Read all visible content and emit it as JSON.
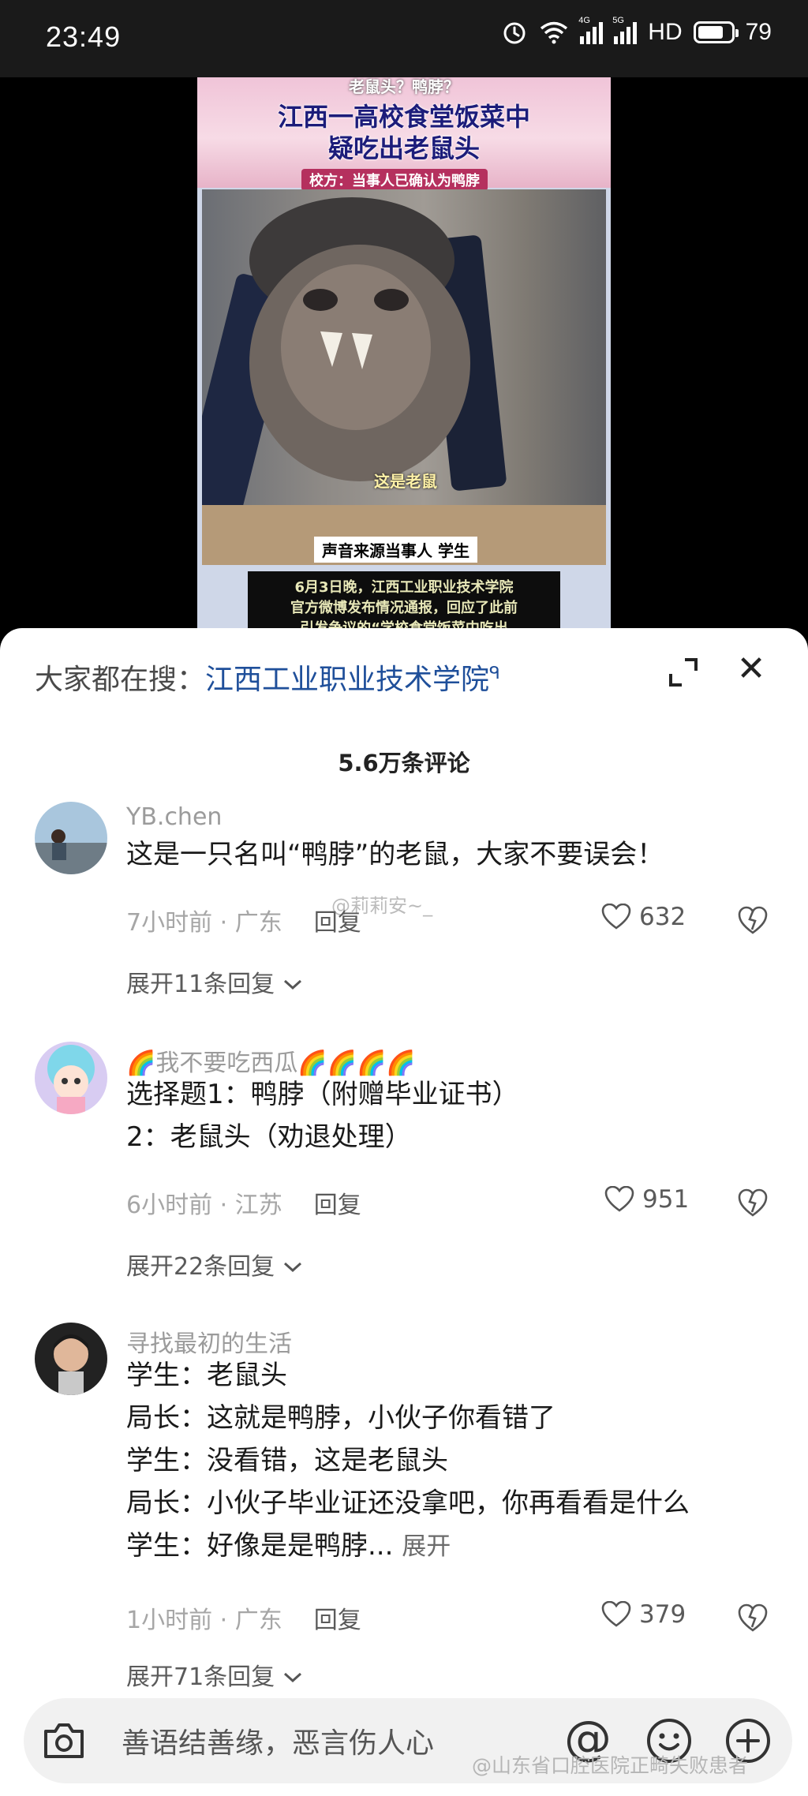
{
  "status_bar": {
    "time": "23:49",
    "network_tag_1": "4G",
    "network_tag_2": "5G",
    "hd_label": "HD",
    "battery": "79",
    "battery_level": 0.79
  },
  "video": {
    "top_text": "老鼠头？鸭脖？",
    "title_line1": "江西一高校食堂饭菜中",
    "title_line2": "疑吃出老鼠头",
    "subtitle": "校方：当事人已确认为鸭脖",
    "caption": "这是老鼠",
    "source": "声音来源当事人 学生",
    "text_lines": [
      "6月3日晚，江西工业职业技术学院",
      "官方微博发布情况通报，回应了此前",
      "引发争议的“学校食堂饭菜中吃出"
    ]
  },
  "search_bar": {
    "label": "大家都在搜：",
    "term": "江西工业职业技术学院",
    "search_glyph": "ᑫ"
  },
  "comment_count": "5.6万条评论",
  "comments": [
    {
      "user": "YB.chen",
      "lines": [
        "这是一只名叫“鸭脖”的老鼠，大家不要误会！"
      ],
      "time": "7小时前 · 广东",
      "reply": "回复",
      "likes": "632",
      "more": "展开11条回复"
    },
    {
      "user": "🌈我不要吃西瓜🌈🌈🌈🌈",
      "lines": [
        "选择题1：鸭脖（附赠毕业证书）",
        "2：老鼠头（劝退处理）"
      ],
      "time": "6小时前 · 江苏",
      "reply": "回复",
      "likes": "951",
      "more": "展开22条回复"
    },
    {
      "user": "寻找最初的生活",
      "lines": [
        "学生：老鼠头",
        "局长：这就是鸭脖，小伙子你看错了",
        "学生：没看错，这是老鼠头",
        "局长：小伙子毕业证还没拿吧，你再看看是什么",
        "学生：好像是是鸭脖..."
      ],
      "expand": "展开",
      "time": "1小时前 · 广东",
      "reply": "回复",
      "likes": "379",
      "more": "展开71条回复"
    }
  ],
  "watermarks": {
    "mid": "@莉莉安~_",
    "bottom": "@山东省口腔医院正畸失败患者"
  },
  "input": {
    "placeholder": "善语结善缘，恶言伤人心",
    "at_symbol": "@"
  },
  "close_symbol": "✕"
}
